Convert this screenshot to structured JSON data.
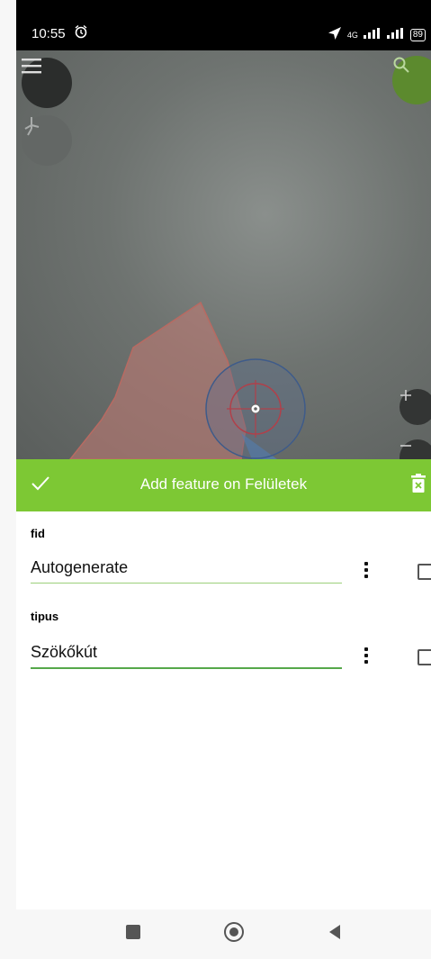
{
  "status_bar": {
    "time": "10:55",
    "network": "4G",
    "battery": "89"
  },
  "toolbar": {
    "title": "Add feature on Felületek"
  },
  "fields": [
    {
      "label": "fid",
      "value": "Autogenerate"
    },
    {
      "label": "tipus",
      "value": "Szökőkút"
    }
  ],
  "colors": {
    "accent": "#7dc834",
    "status_bar": "#000000",
    "polygon_fill": "#c47a72"
  },
  "icons": {
    "map": [
      "menu-icon",
      "tracking-icon",
      "search-icon",
      "zoom-in-icon",
      "zoom-out-icon",
      "crosshair-icon"
    ],
    "toolbar": [
      "check-icon",
      "delete-icon"
    ],
    "navbar": [
      "recents-icon",
      "home-icon",
      "back-icon"
    ]
  }
}
